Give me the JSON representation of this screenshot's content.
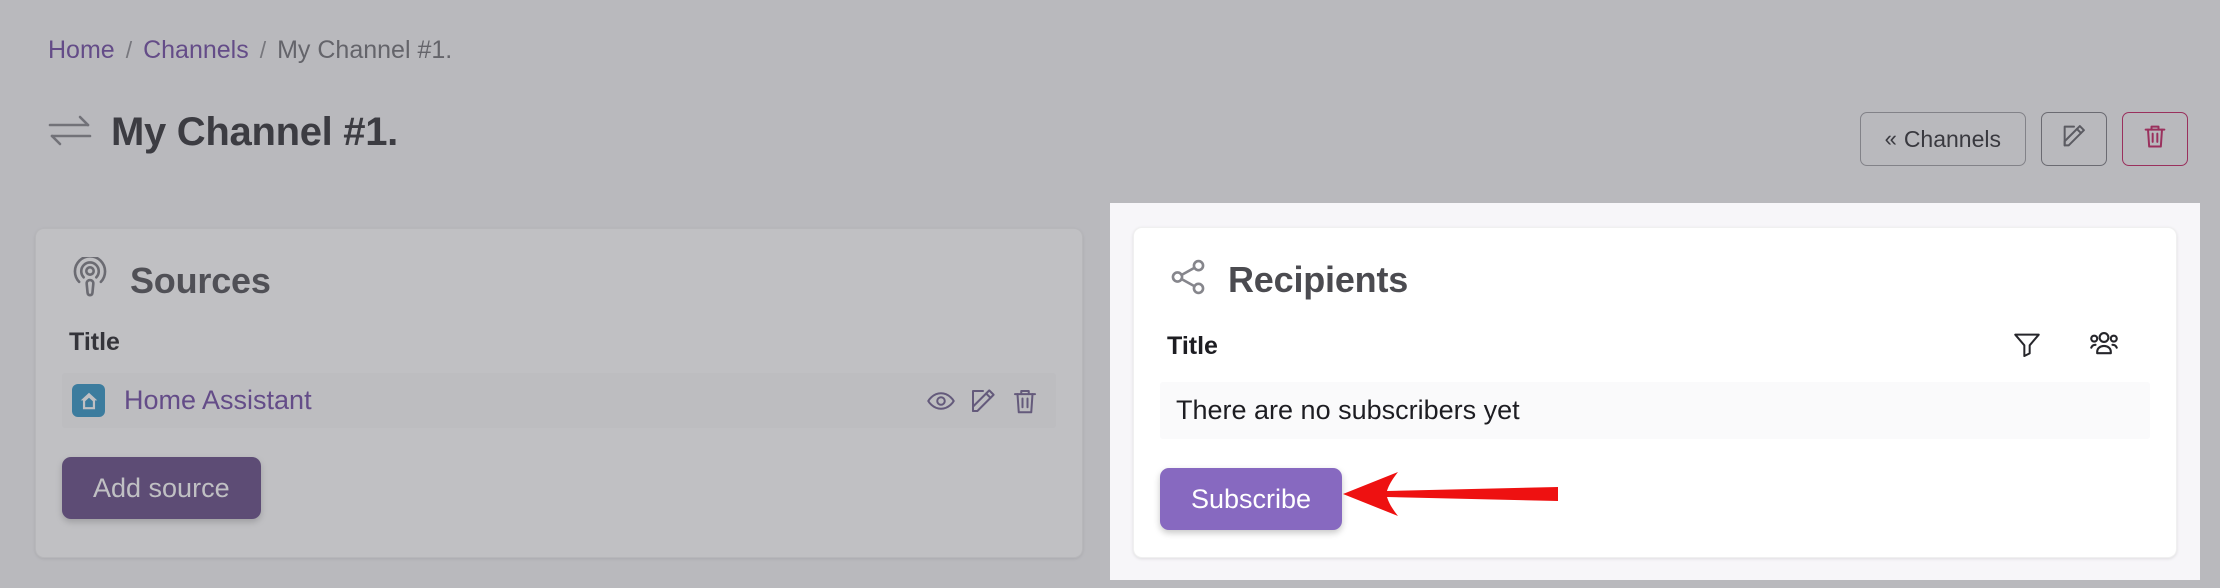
{
  "breadcrumb": {
    "items": [
      {
        "label": "Home",
        "type": "link"
      },
      {
        "label": "Channels",
        "type": "link"
      },
      {
        "label": "My Channel #1.",
        "type": "current"
      }
    ],
    "separator": "/"
  },
  "header": {
    "icon": "exchange-arrows-icon",
    "title": "My Channel #1.",
    "actions": {
      "back_label": "Channels",
      "back_chevron": "«",
      "edit_icon": "pencil-square-icon",
      "delete_icon": "trash-icon",
      "delete_accent": "#c2185b"
    }
  },
  "sources_card": {
    "icon": "podcast-icon",
    "title": "Sources",
    "column_header": "Title",
    "rows": [
      {
        "logo": "home-assistant-icon",
        "logo_color": "#2b92c4",
        "label": "Home Assistant",
        "actions": [
          "eye-icon",
          "pencil-square-icon",
          "trash-icon"
        ]
      }
    ],
    "add_button": "Add source"
  },
  "recipients_card": {
    "icon": "share-nodes-icon",
    "title": "Recipients",
    "column_header": "Title",
    "tools": [
      "filter-funnel-icon",
      "users-group-icon"
    ],
    "empty_message": "There are no subscribers yet",
    "subscribe_button": "Subscribe"
  },
  "annotation": {
    "arrow": "red-left-arrow",
    "arrow_color": "#ee1111"
  },
  "theme": {
    "page_background": "#a8a8aa",
    "spotlight_background": "#f7f6f9",
    "card_background": "#ffffff",
    "accent_purple": "#6b45a0",
    "primary_button": "#8769c0"
  }
}
